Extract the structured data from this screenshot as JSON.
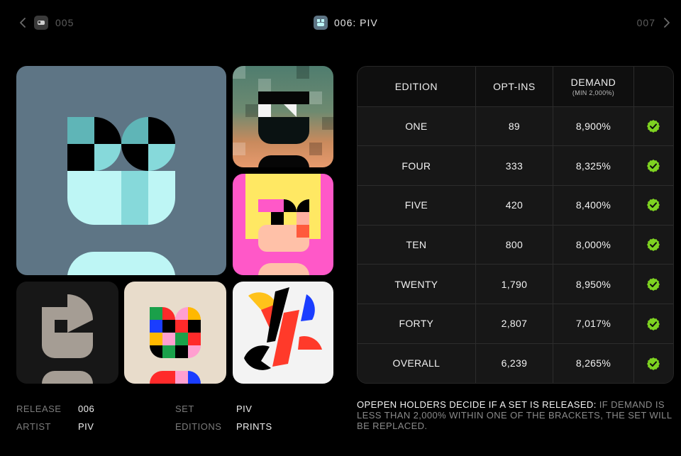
{
  "nav": {
    "prev_label": "005",
    "current_label": "006: PIV",
    "next_label": "007"
  },
  "table": {
    "headers": {
      "edition": "EDITION",
      "optins": "OPT-INS",
      "demand": "DEMAND",
      "demand_sub": "(MIN 2,000%)"
    },
    "rows": [
      {
        "edition": "ONE",
        "optins": "89",
        "demand": "8,900%",
        "status": "check-circle-icon"
      },
      {
        "edition": "FOUR",
        "optins": "333",
        "demand": "8,325%",
        "status": "check-circle-icon"
      },
      {
        "edition": "FIVE",
        "optins": "420",
        "demand": "8,400%",
        "status": "check-circle-icon"
      },
      {
        "edition": "TEN",
        "optins": "800",
        "demand": "8,000%",
        "status": "check-circle-icon"
      },
      {
        "edition": "TWENTY",
        "optins": "1,790",
        "demand": "8,950%",
        "status": "check-circle-icon"
      },
      {
        "edition": "FORTY",
        "optins": "2,807",
        "demand": "7,017%",
        "status": "check-circle-icon"
      },
      {
        "edition": "OVERALL",
        "optins": "6,239",
        "demand": "8,265%",
        "status": "check-circle-icon"
      }
    ]
  },
  "meta": {
    "release_label": "RELEASE",
    "release_value": "006",
    "artist_label": "ARTIST",
    "artist_value": "PIV",
    "set_label": "SET",
    "set_value": "PIV",
    "editions_label": "EDITIONS",
    "editions_value": "PRINTS"
  },
  "note": {
    "strong": "OPEPEN HOLDERS DECIDE IF A SET IS RELEASED:",
    "rest": " IF DEMAND IS LESS THAN 2,000% WITHIN ONE OF THE BRACKETS, THE SET WILL BE REPLACED."
  },
  "colors": {
    "background": "#000000",
    "check_green": "#7ed321",
    "muted_text": "#7b7b7b"
  }
}
